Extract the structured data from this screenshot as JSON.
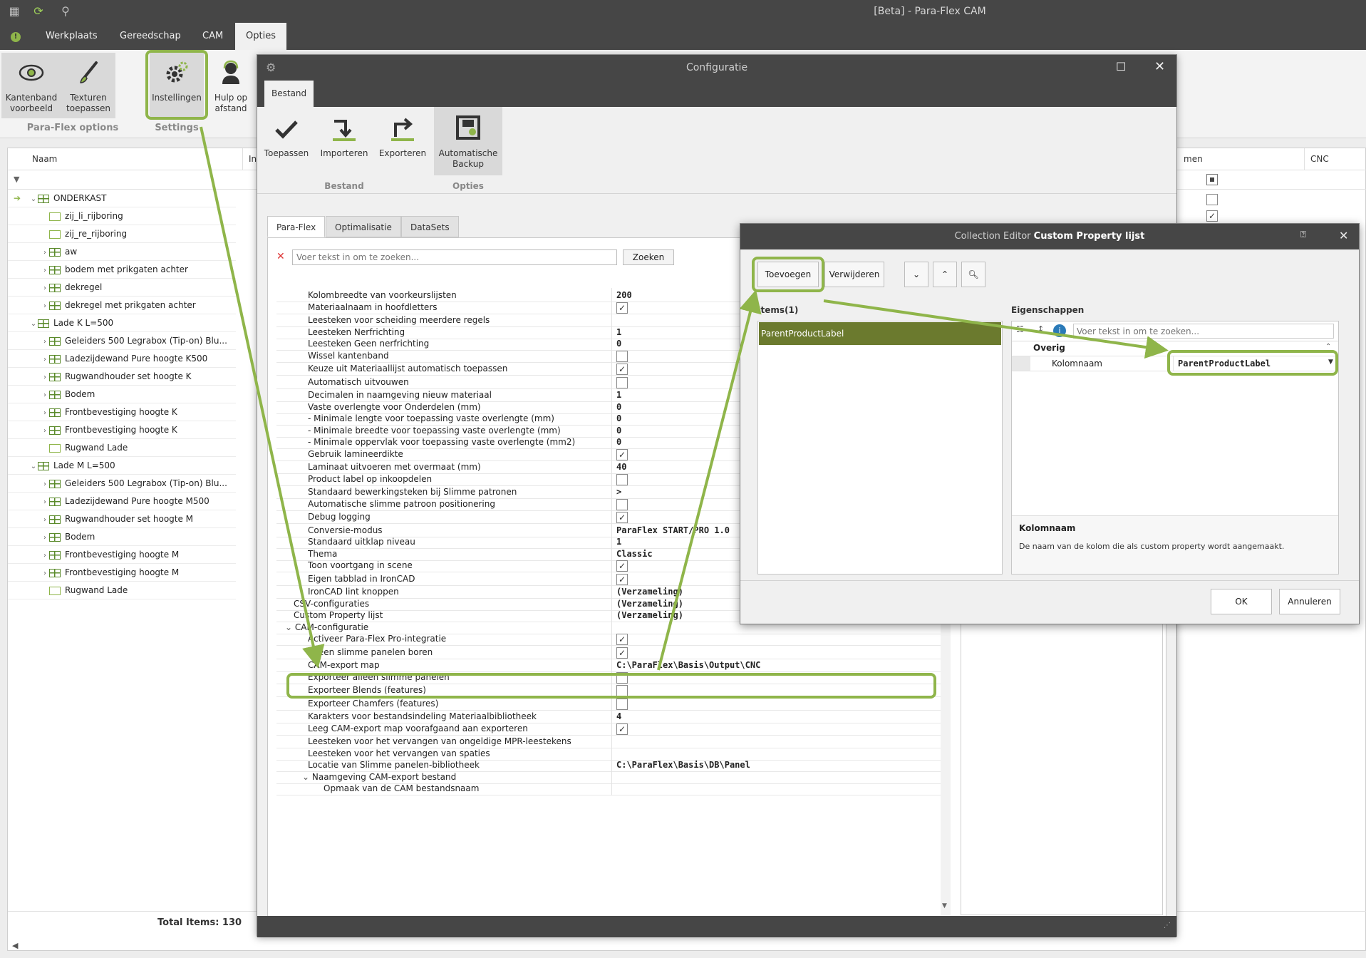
{
  "window": {
    "title": "[Beta] - Para-Flex CAM"
  },
  "menu": {
    "tabs": [
      {
        "label": "Werkplaats"
      },
      {
        "label": "Gereedschap"
      },
      {
        "label": "CAM"
      },
      {
        "label": "Opties"
      }
    ],
    "info_glyph": "!"
  },
  "ribbon": {
    "buttons": [
      {
        "line1": "Kantenband",
        "line2": "voorbeeld",
        "icon": "eye-icon"
      },
      {
        "line1": "Texturen",
        "line2": "toepassen",
        "icon": "brush-icon"
      },
      {
        "line1": "Instellingen",
        "line2": "",
        "icon": "gears-icon"
      },
      {
        "line1": "Hulp op",
        "line2": "afstand",
        "icon": "support-icon"
      }
    ],
    "groups": [
      "Para-Flex options",
      "Settings"
    ]
  },
  "grid": {
    "columns": [
      "Naam",
      "Inko",
      "men",
      "CNC"
    ],
    "footer": "Total Items: 130",
    "rows": [
      {
        "label": "ONDERKAST",
        "type": "group",
        "level": 0,
        "expanded": true
      },
      {
        "label": "zij_li_rijboring",
        "type": "item",
        "level": 1
      },
      {
        "label": "zij_re_rijboring",
        "type": "item",
        "level": 1
      },
      {
        "label": "aw",
        "type": "group",
        "level": 1
      },
      {
        "label": "bodem met prikgaten achter",
        "type": "group",
        "level": 1
      },
      {
        "label": "dekregel",
        "type": "group",
        "level": 1
      },
      {
        "label": "dekregel met prikgaten achter",
        "type": "group",
        "level": 1
      },
      {
        "label": "Lade K L=500",
        "type": "group",
        "level": 0,
        "expanded": true
      },
      {
        "label": "Geleiders 500 Legrabox (Tip-on) Blu...",
        "type": "group",
        "level": 1
      },
      {
        "label": "Ladezijdewand Pure hoogte K500",
        "type": "group",
        "level": 1
      },
      {
        "label": "Rugwandhouder set hoogte K",
        "type": "group",
        "level": 1
      },
      {
        "label": "Bodem",
        "type": "group",
        "level": 1
      },
      {
        "label": "Frontbevestiging hoogte K",
        "type": "group",
        "level": 1
      },
      {
        "label": "Frontbevestiging hoogte K",
        "type": "group",
        "level": 1
      },
      {
        "label": "Rugwand Lade",
        "type": "item",
        "level": 1
      },
      {
        "label": "Lade M L=500",
        "type": "group",
        "level": 0,
        "expanded": true
      },
      {
        "label": "Geleiders 500 Legrabox (Tip-on) Blu...",
        "type": "group",
        "level": 1
      },
      {
        "label": "Ladezijdewand Pure hoogte M500",
        "type": "group",
        "level": 1
      },
      {
        "label": "Rugwandhouder set hoogte M",
        "type": "group",
        "level": 1
      },
      {
        "label": "Bodem",
        "type": "group",
        "level": 1
      },
      {
        "label": "Frontbevestiging hoogte M",
        "type": "group",
        "level": 1
      },
      {
        "label": "Frontbevestiging hoogte M",
        "type": "group",
        "level": 1
      },
      {
        "label": "Rugwand Lade",
        "type": "item",
        "level": 1
      }
    ]
  },
  "config": {
    "title": "Configuratie",
    "tab": "Bestand",
    "buttons": [
      {
        "label": "Toepassen",
        "label2": "",
        "icon": "check-icon"
      },
      {
        "label": "Importeren",
        "label2": "",
        "icon": "import-icon"
      },
      {
        "label": "Exporteren",
        "label2": "",
        "icon": "export-icon"
      },
      {
        "label": "Automatische",
        "label2": "Backup",
        "icon": "backup-icon"
      }
    ],
    "groups": [
      "Bestand",
      "Opties"
    ],
    "pg_tabs": [
      "Para-Flex",
      "Optimalisatie",
      "DataSets"
    ],
    "search_placeholder": "Voer tekst in om te zoeken...",
    "search_button": "Zoeken",
    "properties": [
      {
        "name": "Kolombreedte van voorkeurslijsten",
        "value": "200",
        "kind": "text",
        "indent": 2
      },
      {
        "name": "Materiaalnaam in hoofdletters",
        "value": "✓",
        "kind": "check",
        "indent": 2
      },
      {
        "name": "Leesteken voor scheiding meerdere regels",
        "value": "",
        "kind": "text",
        "indent": 2
      },
      {
        "name": "Leesteken Nerfrichting",
        "value": "1",
        "kind": "text",
        "indent": 2
      },
      {
        "name": "Leesteken Geen nerfrichting",
        "value": "0",
        "kind": "text",
        "indent": 2
      },
      {
        "name": "Wissel kantenband",
        "value": "",
        "kind": "check",
        "indent": 2
      },
      {
        "name": "Keuze uit Materiaallijst automatisch toepassen",
        "value": "✓",
        "kind": "check",
        "indent": 2
      },
      {
        "name": "Automatisch uitvouwen",
        "value": "",
        "kind": "check",
        "indent": 2
      },
      {
        "name": "Decimalen in naamgeving nieuw materiaal",
        "value": "1",
        "kind": "text",
        "indent": 2
      },
      {
        "name": "Vaste overlengte voor Onderdelen (mm)",
        "value": "0",
        "kind": "text",
        "indent": 2
      },
      {
        "name": "- Minimale lengte voor toepassing vaste overlengte (mm)",
        "value": "0",
        "kind": "text",
        "indent": 2
      },
      {
        "name": "- Minimale breedte voor toepassing vaste overlengte (mm)",
        "value": "0",
        "kind": "text",
        "indent": 2
      },
      {
        "name": "- Minimale oppervlak voor toepassing vaste overlengte (mm2)",
        "value": "0",
        "kind": "text",
        "indent": 2
      },
      {
        "name": "Gebruik lamineerdikte",
        "value": "✓",
        "kind": "check",
        "indent": 2
      },
      {
        "name": "Laminaat uitvoeren met overmaat (mm)",
        "value": "40",
        "kind": "text",
        "indent": 2
      },
      {
        "name": "Product label op inkoopdelen",
        "value": "",
        "kind": "check",
        "indent": 2
      },
      {
        "name": "Standaard bewerkingsteken bij Slimme patronen",
        "value": ">",
        "kind": "text",
        "indent": 2
      },
      {
        "name": "Automatische slimme patroon positionering",
        "value": "",
        "kind": "check",
        "indent": 2
      },
      {
        "name": "Debug logging",
        "value": "✓",
        "kind": "check",
        "indent": 2
      },
      {
        "name": "Conversie-modus",
        "value": "ParaFlex START/PRO 1.0",
        "kind": "text",
        "indent": 2
      },
      {
        "name": "Standaard uitklap niveau",
        "value": "1",
        "kind": "text",
        "indent": 2
      },
      {
        "name": "Thema",
        "value": "Classic",
        "kind": "text",
        "indent": 2
      },
      {
        "name": "Toon voortgang in scene",
        "value": "✓",
        "kind": "check",
        "indent": 2
      },
      {
        "name": "Eigen tabblad in IronCAD",
        "value": "✓",
        "kind": "check",
        "indent": 2
      },
      {
        "name": "IronCAD lint knoppen",
        "value": "(Verzameling)",
        "kind": "text",
        "indent": 2
      },
      {
        "name": "CSV-configuraties",
        "value": "(Verzameling)",
        "kind": "text",
        "indent": 1
      },
      {
        "name": "Custom Property lijst",
        "value": "(Verzameling)",
        "kind": "text",
        "indent": 1,
        "ellipsis": "···"
      },
      {
        "name": "CAM-configuratie",
        "value": "",
        "kind": "category",
        "indent": 1
      },
      {
        "name": "Activeer Para-Flex Pro-integratie",
        "value": "✓",
        "kind": "check",
        "indent": 2
      },
      {
        "name": "Alleen slimme panelen boren",
        "value": "✓",
        "kind": "check",
        "indent": 2
      },
      {
        "name": "CAM-export map",
        "value": "C:\\ParaFlex\\Basis\\Output\\CNC",
        "kind": "text",
        "indent": 2
      },
      {
        "name": "Exporteer alleen slimme panelen",
        "value": "",
        "kind": "check",
        "indent": 2
      },
      {
        "name": "Exporteer Blends (features)",
        "value": "",
        "kind": "check",
        "indent": 2
      },
      {
        "name": "Exporteer Chamfers (features)",
        "value": "",
        "kind": "check",
        "indent": 2
      },
      {
        "name": "Karakters voor bestandsindeling Materiaalbibliotheek",
        "value": "4",
        "kind": "text",
        "indent": 2
      },
      {
        "name": "Leeg CAM-export map voorafgaand aan exporteren",
        "value": "✓",
        "kind": "check",
        "indent": 2
      },
      {
        "name": "Leesteken voor het vervangen van ongeldige MPR-leestekens",
        "value": "",
        "kind": "text",
        "indent": 2
      },
      {
        "name": "Leesteken voor het vervangen van spaties",
        "value": "",
        "kind": "text",
        "indent": 2
      },
      {
        "name": "Locatie van Slimme panelen-bibliotheek",
        "value": "C:\\ParaFlex\\Basis\\DB\\Panel",
        "kind": "text",
        "indent": 2
      },
      {
        "name": "Naamgeving CAM-export bestand",
        "value": "",
        "kind": "category",
        "indent": 2
      },
      {
        "name": "Opmaak van de CAM bestandsnaam",
        "value": "",
        "kind": "text",
        "indent": 3
      }
    ]
  },
  "collection_editor": {
    "title_prefix": "Collection Editor",
    "title_name": "Custom Property lijst",
    "add": "Toevoegen",
    "remove": "Verwijderen",
    "items_header": "Items(1)",
    "items": [
      "ParentProductLabel"
    ],
    "props_header": "Eigenschappen",
    "search_placeholder": "Voer tekst in om te zoeken...",
    "category": "Overig",
    "prop_name": "Kolomnaam",
    "prop_value": "ParentProductLabel",
    "desc_title": "Kolomnaam",
    "desc_text": "De naam van de kolom die als custom property wordt aangemaakt.",
    "ok": "OK",
    "cancel": "Annuleren"
  },
  "colors": {
    "accent": "#8fb54a",
    "titlebar": "#464646",
    "selected_item": "#6b7a2e"
  }
}
